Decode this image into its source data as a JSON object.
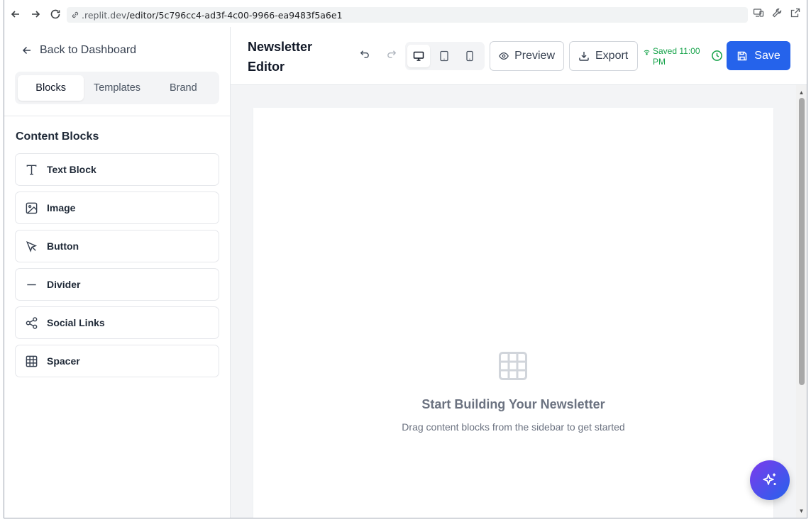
{
  "browser": {
    "url_domain": ".replit.dev",
    "url_path": "/editor/5c796cc4-ad3f-4c00-9966-ea9483f5a6e1"
  },
  "sidebar": {
    "back_label": "Back to Dashboard",
    "tabs": [
      {
        "label": "Blocks",
        "active": true
      },
      {
        "label": "Templates",
        "active": false
      },
      {
        "label": "Brand",
        "active": false
      }
    ],
    "section_title": "Content Blocks",
    "blocks": [
      {
        "label": "Text Block",
        "icon": "type-icon"
      },
      {
        "label": "Image",
        "icon": "image-icon"
      },
      {
        "label": "Button",
        "icon": "pointer-icon"
      },
      {
        "label": "Divider",
        "icon": "minus-icon"
      },
      {
        "label": "Social Links",
        "icon": "share-icon"
      },
      {
        "label": "Spacer",
        "icon": "grid-icon"
      }
    ]
  },
  "header": {
    "title": "Newsletter Editor",
    "preview_label": "Preview",
    "export_label": "Export",
    "saved_status": "Saved 11:00 PM",
    "save_label": "Save",
    "active_device": "desktop"
  },
  "canvas": {
    "empty_title": "Start Building Your Newsletter",
    "empty_subtitle": "Drag content blocks from the sidebar to get started"
  },
  "colors": {
    "primary": "#2563eb",
    "saved_green": "#16a34a",
    "canvas_bg": "#f3f4f6"
  }
}
